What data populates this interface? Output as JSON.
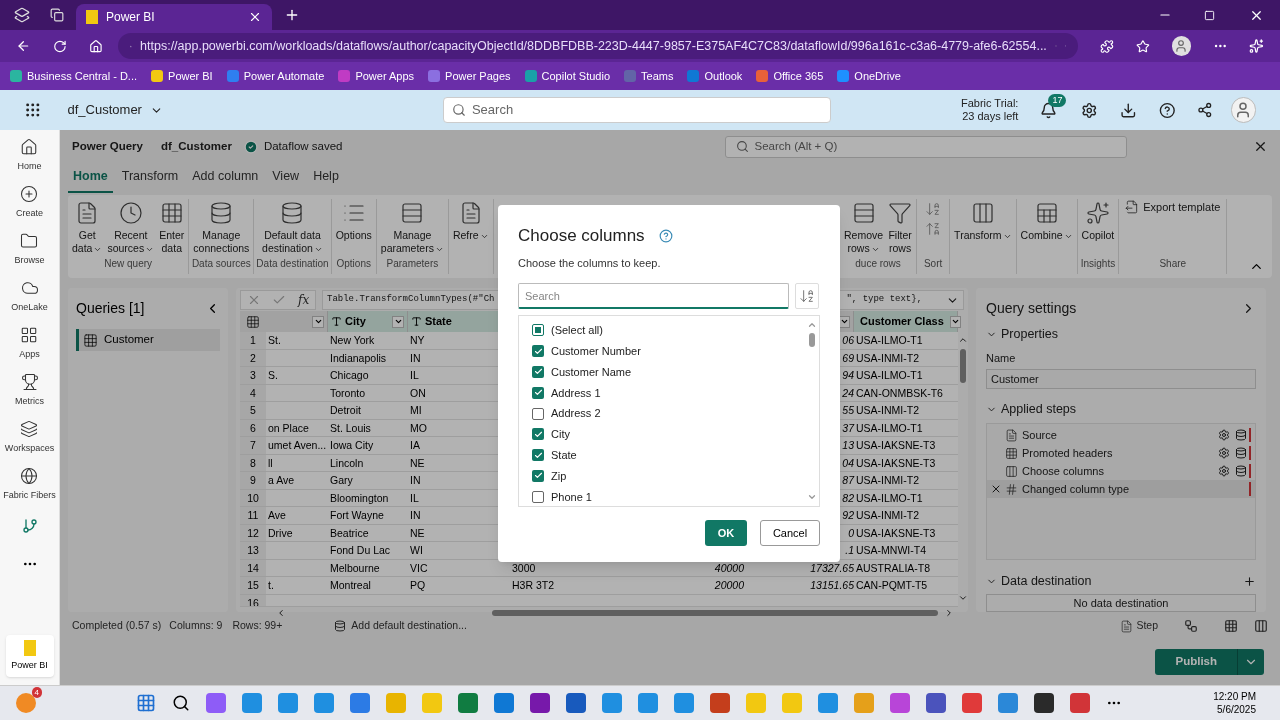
{
  "browser": {
    "tab_title": "Power BI",
    "url": "https://app.powerbi.com/workloads/dataflows/author/capacityObjectId/8DDBFDBB-223D-4447-9857-E375AF4C7C83/dataflowId/996a161c-c3a6-4779-afe6-62554...",
    "bookmarks": [
      {
        "label": "Business Central - D...",
        "color": "#2bb5a0"
      },
      {
        "label": "Power BI",
        "color": "#f2c811"
      },
      {
        "label": "Power Automate",
        "color": "#2f7ff0"
      },
      {
        "label": "Power Apps",
        "color": "#c03bc4"
      },
      {
        "label": "Power Pages",
        "color": "#8b6fe0"
      },
      {
        "label": "Copilot Studio",
        "color": "#1aa0a8"
      },
      {
        "label": "Teams",
        "color": "#6264a7"
      },
      {
        "label": "Outlook",
        "color": "#0f78d4"
      },
      {
        "label": "Office 365",
        "color": "#e8613a"
      },
      {
        "label": "OneDrive",
        "color": "#1e90ff"
      }
    ]
  },
  "header": {
    "app_name": "df_Customer",
    "search_placeholder": "Search",
    "trial_line_1": "Fabric Trial:",
    "trial_line_2": "23 days left",
    "notifications": "17"
  },
  "nav": {
    "items": [
      {
        "label": "Home"
      },
      {
        "label": "Create"
      },
      {
        "label": "Browse"
      },
      {
        "label": "OneLake"
      },
      {
        "label": "Apps"
      },
      {
        "label": "Metrics"
      },
      {
        "label": "Workspaces"
      },
      {
        "label": "Fabric Fibers"
      }
    ],
    "workload": "Power BI"
  },
  "pq": {
    "title": "Power Query",
    "dataflow": "df_Customer",
    "status": "Dataflow saved",
    "search_placeholder": "Search (Alt + Q)",
    "tabs": [
      {
        "label": "Home",
        "selected": true
      },
      {
        "label": "Transform",
        "selected": false
      },
      {
        "label": "Add column",
        "selected": false
      },
      {
        "label": "View",
        "selected": false
      },
      {
        "label": "Help",
        "selected": false
      }
    ],
    "ribbon": {
      "left_groups": [
        {
          "kind": "large",
          "label": "New query",
          "buttons": [
            {
              "lines": [
                "Get",
                "data"
              ],
              "dropdown": true
            },
            {
              "lines": [
                "Recent",
                "sources"
              ],
              "dropdown": true
            },
            {
              "lines": [
                "Enter",
                "data"
              ],
              "dropdown": false
            }
          ]
        },
        {
          "kind": "large",
          "label": "Data sources",
          "buttons": [
            {
              "lines": [
                "Manage",
                "connections"
              ],
              "dropdown": false
            }
          ]
        },
        {
          "kind": "large",
          "label": "Data destination",
          "buttons": [
            {
              "lines": [
                "Default data",
                "destination"
              ],
              "dropdown": true
            }
          ]
        },
        {
          "kind": "large",
          "label": "Options",
          "buttons": [
            {
              "lines": [
                "Options"
              ],
              "dropdown": false
            }
          ]
        },
        {
          "kind": "large",
          "label": "Parameters",
          "buttons": [
            {
              "lines": [
                "Manage",
                "parameters"
              ],
              "dropdown": true
            }
          ]
        },
        {
          "kind": "large",
          "buttons": [
            {
              "lines": [
                "Refre"
              ],
              "dropdown": true
            }
          ]
        }
      ],
      "right_groups": [
        {
          "kind": "large",
          "label": "duce rows",
          "buttons": [
            {
              "lines": [
                "Remove",
                "rows"
              ],
              "dropdown": true
            },
            {
              "lines": [
                "Filter",
                "rows"
              ],
              "dropdown": false
            }
          ]
        },
        {
          "kind": "sort",
          "label": "Sort"
        },
        {
          "kind": "large",
          "buttons": [
            {
              "lines": [
                "Transform"
              ],
              "dropdown": true
            }
          ]
        },
        {
          "kind": "large",
          "buttons": [
            {
              "lines": [
                "Combine"
              ],
              "dropdown": true
            }
          ]
        },
        {
          "kind": "large",
          "label": "Insights",
          "buttons": [
            {
              "lines": [
                "Copilot"
              ],
              "dropdown": false
            }
          ]
        },
        {
          "kind": "link",
          "label": "Share",
          "buttons": [
            {
              "lines": [
                "Export template"
              ]
            }
          ]
        }
      ]
    },
    "queries": {
      "title": "Queries [1]",
      "items": [
        {
          "label": "Customer",
          "selected": true
        }
      ]
    },
    "formula": {
      "function_label": "fx",
      "visible_start": "Table.TransformColumnTypes(#\"Ch",
      "visible_end": "\", type text},"
    },
    "table": {
      "headers": {
        "city": "City",
        "state": "State",
        "customer_class": "Customer Class"
      },
      "rows": [
        {
          "n": "1",
          "column_1": "St.",
          "city": "New York",
          "state": "NY",
          "column_7": "06",
          "customer_class": "USA-ILMO-T1"
        },
        {
          "n": "2",
          "city": "Indianapolis",
          "state": "IN",
          "column_7": "69",
          "customer_class": "USA-INMI-T2"
        },
        {
          "n": "3",
          "column_1": "S.",
          "city": "Chicago",
          "state": "IL",
          "column_7": "94",
          "customer_class": "USA-ILMO-T1"
        },
        {
          "n": "4",
          "city": "Toronto",
          "state": "ON",
          "column_7": "24",
          "customer_class": "CAN-ONMBSK-T6"
        },
        {
          "n": "5",
          "city": "Detroit",
          "state": "MI",
          "column_7": "55",
          "customer_class": "USA-INMI-T2"
        },
        {
          "n": "6",
          "column_1": "on Place",
          "city": "St. Louis",
          "state": "MO",
          "column_7": "37",
          "customer_class": "USA-ILMO-T1"
        },
        {
          "n": "7",
          "column_1": "umet Aven...",
          "city": "Iowa City",
          "state": "IA",
          "column_7": "13",
          "customer_class": "USA-IAKSNE-T3"
        },
        {
          "n": "8",
          "column_1": "ll",
          "city": "Lincoln",
          "state": "NE",
          "column_7": "04",
          "customer_class": "USA-IAKSNE-T3"
        },
        {
          "n": "9",
          "column_1": "a Ave",
          "city": "Gary",
          "state": "IN",
          "column_7": "87",
          "customer_class": "USA-INMI-T2"
        },
        {
          "n": "10",
          "city": "Bloomington",
          "state": "IL",
          "column_7": "82",
          "customer_class": "USA-ILMO-T1"
        },
        {
          "n": "11",
          "column_1": "Ave",
          "city": "Fort Wayne",
          "state": "IN",
          "column_7": "92",
          "customer_class": "USA-INMI-T2"
        },
        {
          "n": "12",
          "column_1": "Drive",
          "city": "Beatrice",
          "state": "NE",
          "column_7": "0",
          "customer_class": "USA-IAKSNE-T3"
        },
        {
          "n": "13",
          "city": "Fond Du Lac",
          "state": "WI",
          "column_7": ".1",
          "customer_class": "USA-MNWI-T4"
        },
        {
          "n": "14",
          "city": "Melbourne",
          "state": "VIC",
          "column_5": "3000",
          "column_6": "40000",
          "column_7": "17327.65",
          "customer_class": "AUSTRALIA-T8"
        },
        {
          "n": "15",
          "column_1": "t.",
          "city": "Montreal",
          "state": "PQ",
          "column_5": "H3R 3T2",
          "column_6": "20000",
          "column_7": "13151.65",
          "customer_class": "CAN-PQMT-T5"
        },
        {
          "n": "16"
        }
      ]
    },
    "settings": {
      "title": "Query settings",
      "properties": "Properties",
      "name_label": "Name",
      "name_value": "Customer",
      "steps_title": "Applied steps",
      "steps": [
        {
          "kind": "source",
          "label": "Source",
          "selected": false
        },
        {
          "kind": "table",
          "label": "Promoted headers",
          "selected": false
        },
        {
          "kind": "columns",
          "label": "Choose columns",
          "selected": false
        },
        {
          "kind": "type",
          "label": "Changed column type",
          "selected": true
        }
      ],
      "destination_title": "Data destination",
      "destination_value": "No data destination"
    },
    "status_bar": {
      "completed": "Completed (0.57 s)",
      "columns": "Columns: 9",
      "rows": "Rows: 99+",
      "destination": "Add default destination...",
      "step": "Step"
    },
    "publish": "Publish"
  },
  "dialog": {
    "title": "Choose columns",
    "subtitle": "Choose the columns to keep.",
    "search_placeholder": "Search",
    "select_all": {
      "label": "(Select all)",
      "indeterminate": true
    },
    "columns": [
      {
        "label": "Customer Number",
        "checked": true
      },
      {
        "label": "Customer Name",
        "checked": true
      },
      {
        "label": "Address 1",
        "checked": true
      },
      {
        "label": "Address 2",
        "checked": false
      },
      {
        "label": "City",
        "checked": true
      },
      {
        "label": "State",
        "checked": true
      },
      {
        "label": "Zip",
        "checked": true
      },
      {
        "label": "Phone 1",
        "checked": false
      }
    ],
    "ok": "OK",
    "cancel": "Cancel"
  },
  "taskbar": {
    "badge": "4",
    "time": "12:20 PM",
    "date": "5/6/2025"
  }
}
